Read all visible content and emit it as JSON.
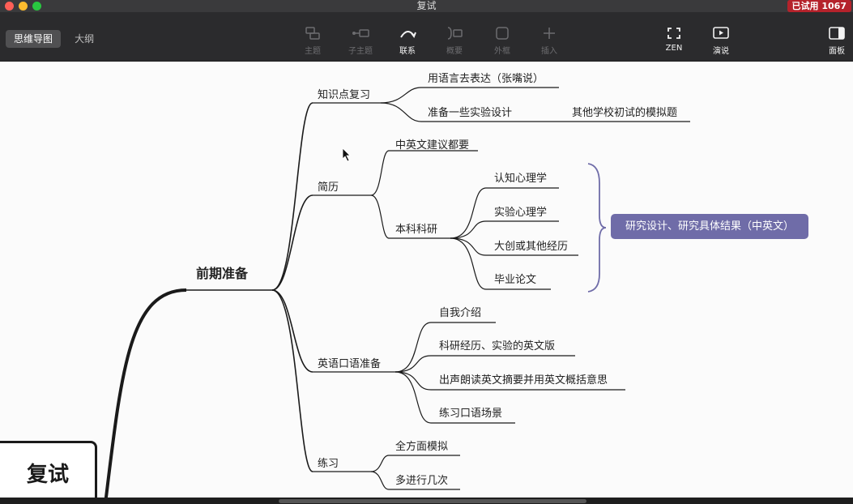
{
  "window": {
    "title": "复试",
    "trial_badge": "已试用 1067"
  },
  "view_tabs": [
    {
      "label": "思维导图",
      "active": true
    },
    {
      "label": "大纲",
      "active": false
    }
  ],
  "toolbar": {
    "topic": "主题",
    "subtopic": "子主题",
    "relation": "联系",
    "summary": "概要",
    "boundary": "外框",
    "insert": "插入",
    "zen": "ZEN",
    "present": "演说",
    "panel": "面板"
  },
  "map": {
    "root": "复试",
    "main": "前期准备",
    "branches": {
      "knowledge": {
        "label": "知识点复习",
        "children": [
          "用语言去表达（张嘴说）",
          "准备一些实验设计"
        ],
        "grandchild": "其他学校初试的模拟题"
      },
      "resume": {
        "label": "简历",
        "children": [
          "中英文建议都要",
          "本科科研"
        ],
        "research": [
          "认知心理学",
          "实验心理学",
          "大创或其他经历",
          "毕业论文"
        ],
        "summary": "研究设计、研究具体结果（中英文）"
      },
      "oral": {
        "label": "英语口语准备",
        "children": [
          "自我介绍",
          "科研经历、实验的英文版",
          "出声朗读英文摘要并用英文概括意思",
          "练习口语场景"
        ]
      },
      "practice": {
        "label": "练习",
        "children": [
          "全方面模拟",
          "多进行几次"
        ]
      }
    }
  }
}
